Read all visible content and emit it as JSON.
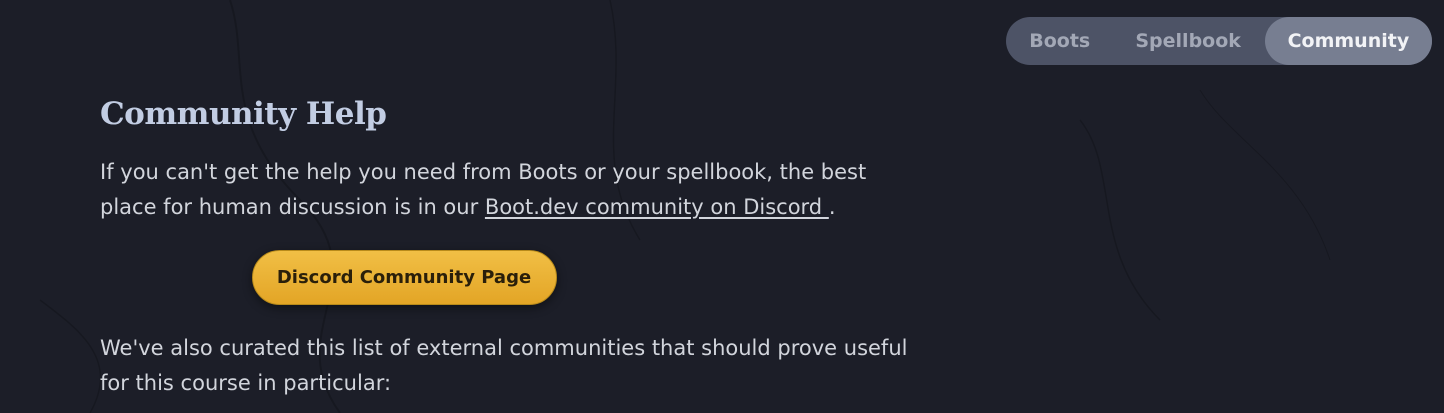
{
  "tabs": [
    {
      "label": "Boots"
    },
    {
      "label": "Spellbook"
    },
    {
      "label": "Community"
    }
  ],
  "active_tab": "Community",
  "heading": "Community Help",
  "intro": {
    "text_before_link": "If you can't get the help you need from Boots or your spellbook, the best place for human discussion is in our ",
    "link_label": "Boot.dev community on Discord ",
    "text_after_link": "."
  },
  "cta_label": "Discord Community Page",
  "curated_text": "We've also curated this list of external communities that should prove useful for this course in particular:",
  "colors": {
    "background": "#1c1e28",
    "accent": "#e9b236",
    "tab_active": "#777e91",
    "tab_bar": "#4d5366"
  }
}
